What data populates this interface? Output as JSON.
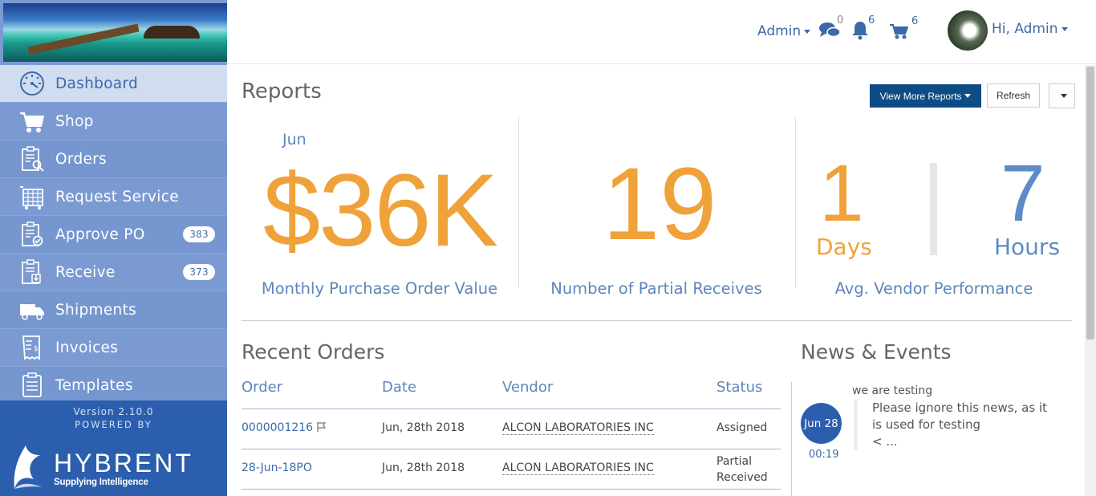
{
  "header": {
    "admin_menu": "Admin",
    "messages_count": "0",
    "notifications_count": "6",
    "cart_count": "6",
    "user_greeting": "Hi, Admin"
  },
  "sidebar": {
    "items": [
      {
        "label": "Dashboard",
        "icon": "dashboard-icon"
      },
      {
        "label": "Shop",
        "icon": "cart-icon"
      },
      {
        "label": "Orders",
        "icon": "clipboard-search-icon"
      },
      {
        "label": "Request Service",
        "icon": "calendar-grid-icon"
      },
      {
        "label": "Approve PO",
        "icon": "clipboard-check-icon",
        "badge": "383"
      },
      {
        "label": "Receive",
        "icon": "clipboard-download-icon",
        "badge": "373"
      },
      {
        "label": "Shipments",
        "icon": "truck-icon"
      },
      {
        "label": "Invoices",
        "icon": "invoice-icon"
      },
      {
        "label": "Templates",
        "icon": "clipboard-list-icon"
      }
    ],
    "version": "Version 2.10.0",
    "powered_by": "POWERED BY",
    "brand_name": "HYBRENT",
    "brand_tagline": "Supplying Intelligence"
  },
  "reports": {
    "title": "Reports",
    "view_more_label": "View More Reports",
    "refresh_label": "Refresh",
    "kpi1": {
      "month": "Jun",
      "value": "$36K",
      "label": "Monthly Purchase Order Value"
    },
    "kpi2": {
      "value": "19",
      "label": "Number of Partial Receives"
    },
    "kpi3": {
      "days_value": "1",
      "days_unit": "Days",
      "hours_value": "7",
      "hours_unit": "Hours",
      "label": "Avg. Vendor Performance"
    }
  },
  "recent_orders": {
    "title": "Recent Orders",
    "columns": [
      "Order",
      "Date",
      "Vendor",
      "Status"
    ],
    "rows": [
      {
        "order": "0000001216",
        "date": "Jun, 28th 2018",
        "vendor": "ALCON LABORATORIES INC",
        "status": "Assigned"
      },
      {
        "order": "28-Jun-18PO",
        "date": "Jun, 28th 2018",
        "vendor": "ALCON LABORATORIES INC",
        "status": "Partial Received"
      }
    ]
  },
  "news": {
    "title": "News & Events",
    "subject": "we are testing",
    "date": "Jun 28",
    "time": "00:19",
    "body": "Please ignore this news, as it is used for testing",
    "more": "< ..."
  },
  "colors": {
    "accent_orange": "#f0a23a",
    "accent_blue": "#5d8bc6",
    "primary_button": "#0e4c85",
    "sidebar_bg": "#7d9bd3",
    "sidebar_footer": "#2b5fae"
  }
}
